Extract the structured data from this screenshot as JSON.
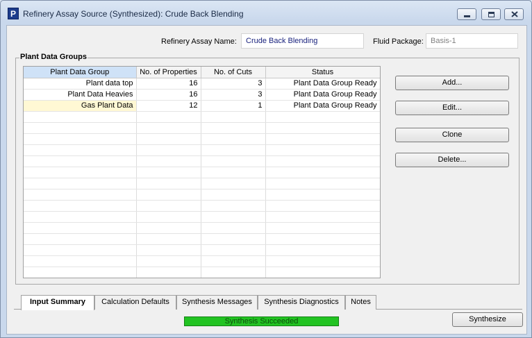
{
  "window": {
    "title": "Refinery Assay Source (Synthesized): Crude Back Blending",
    "app_icon_letter": "P",
    "app_icon_color": "#1c3c8c"
  },
  "header": {
    "assay_name_label": "Refinery Assay Name:",
    "assay_name_value": "Crude Back Blending",
    "fluid_package_label": "Fluid Package:",
    "fluid_package_value": "Basis-1"
  },
  "plant_data_groups": {
    "title": "Plant Data Groups",
    "columns": [
      "Plant Data Group",
      "No. of Properties",
      "No. of Cuts",
      "Status"
    ],
    "rows": [
      {
        "name": "Plant data top",
        "properties": "16",
        "cuts": "3",
        "status": "Plant Data Group Ready"
      },
      {
        "name": "Plant Data Heavies",
        "properties": "16",
        "cuts": "3",
        "status": "Plant Data Group Ready"
      },
      {
        "name": "Gas Plant Data",
        "properties": "12",
        "cuts": "1",
        "status": "Plant Data Group Ready"
      }
    ],
    "buttons": {
      "add": "Add...",
      "edit": "Edit...",
      "clone": "Clone",
      "delete": "Delete..."
    }
  },
  "tabs": [
    {
      "label": "Input Summary",
      "active": true
    },
    {
      "label": "Calculation Defaults",
      "active": false
    },
    {
      "label": "Synthesis Messages",
      "active": false
    },
    {
      "label": "Synthesis Diagnostics",
      "active": false
    },
    {
      "label": "Notes",
      "active": false
    }
  ],
  "footer": {
    "status_text": "Synthesis Succeeded",
    "status_color": "#22c322",
    "synthesize_label": "Synthesize"
  }
}
